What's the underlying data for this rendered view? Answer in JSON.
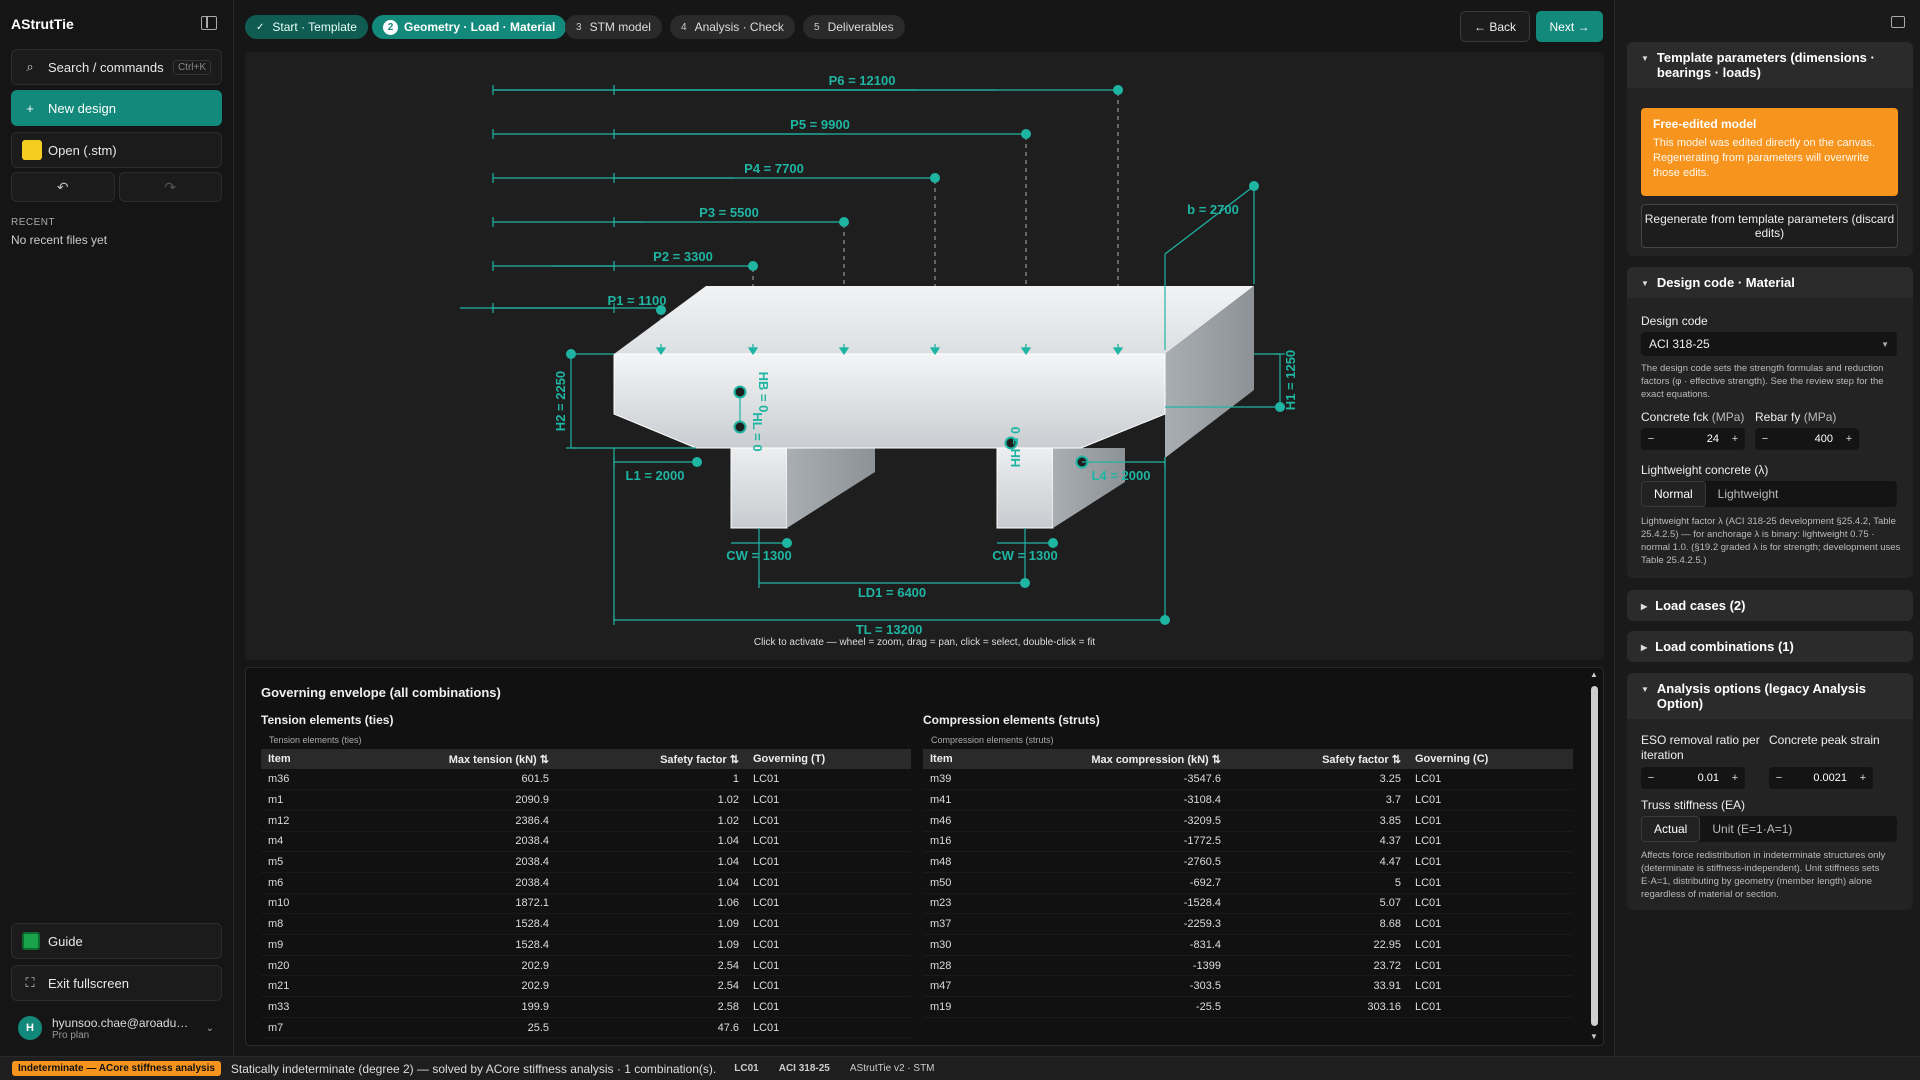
{
  "app": {
    "title": "AStrutTie"
  },
  "sidebar": {
    "search_label": "Search / commands",
    "search_shortcut": "Ctrl+K",
    "new_design_label": "New design",
    "open_label": "Open (.stm)",
    "undo_icon": "undo-icon",
    "redo_icon": "redo-icon",
    "recent_heading": "RECENT",
    "recent_empty": "No recent files yet",
    "guide_label": "Guide",
    "exit_fullscreen_label": "Exit fullscreen",
    "user": {
      "initial": "H",
      "email": "hyunsoo.chae@aroadus...",
      "plan": "Pro plan"
    }
  },
  "steps": [
    {
      "num": "✓",
      "label": "Start · Template",
      "state": "done"
    },
    {
      "num": "2",
      "label": "Geometry · Load · Material",
      "state": "active"
    },
    {
      "num": "3",
      "label": "STM model",
      "state": "todo"
    },
    {
      "num": "4",
      "label": "Analysis · Check",
      "state": "todo"
    },
    {
      "num": "5",
      "label": "Deliverables",
      "state": "todo"
    }
  ],
  "nav": {
    "back_label": "← Back",
    "next_label": "Next →"
  },
  "canvas": {
    "loads": [
      "P6 = 12100",
      "P5 = 9900",
      "P4 = 7700",
      "P3 = 5500",
      "P2 = 3300",
      "P1 = 1100"
    ],
    "dims": {
      "b": "b = 2700",
      "h2": "H2 = 2250",
      "h1": "H1 = 1250",
      "hb": "HB = 0",
      "hl": "HL = 0",
      "hh": "HH = 0",
      "l1": "L1 = 2000",
      "l4": "L4 = 2000",
      "cw_left": "CW = 1300",
      "cw_right": "CW = 1300",
      "ld1": "LD1 = 6400",
      "tl": "TL = 13200"
    },
    "hint": "Click to activate — wheel = zoom, drag = pan, click = select, double-click = fit"
  },
  "envelope": {
    "title": "Governing envelope (all combinations)",
    "tension": {
      "heading": "Tension elements (ties)",
      "caption": "Tension elements (ties)",
      "columns": [
        "Item",
        "Max tension (kN) ⇅",
        "Safety factor ⇅",
        "Governing (T)"
      ],
      "rows": [
        [
          "m36",
          "601.5",
          "1",
          "LC01"
        ],
        [
          "m1",
          "2090.9",
          "1.02",
          "LC01"
        ],
        [
          "m12",
          "2386.4",
          "1.02",
          "LC01"
        ],
        [
          "m4",
          "2038.4",
          "1.04",
          "LC01"
        ],
        [
          "m5",
          "2038.4",
          "1.04",
          "LC01"
        ],
        [
          "m6",
          "2038.4",
          "1.04",
          "LC01"
        ],
        [
          "m10",
          "1872.1",
          "1.06",
          "LC01"
        ],
        [
          "m8",
          "1528.4",
          "1.09",
          "LC01"
        ],
        [
          "m9",
          "1528.4",
          "1.09",
          "LC01"
        ],
        [
          "m20",
          "202.9",
          "2.54",
          "LC01"
        ],
        [
          "m21",
          "202.9",
          "2.54",
          "LC01"
        ],
        [
          "m33",
          "199.9",
          "2.58",
          "LC01"
        ],
        [
          "m7",
          "25.5",
          "47.6",
          "LC01"
        ]
      ]
    },
    "compression": {
      "heading": "Compression elements (struts)",
      "caption": "Compression elements (struts)",
      "columns": [
        "Item",
        "Max compression (kN) ⇅",
        "Safety factor ⇅",
        "Governing (C)"
      ],
      "rows": [
        [
          "m39",
          "-3547.6",
          "3.25",
          "LC01"
        ],
        [
          "m41",
          "-3108.4",
          "3.7",
          "LC01"
        ],
        [
          "m46",
          "-3209.5",
          "3.85",
          "LC01"
        ],
        [
          "m16",
          "-1772.5",
          "4.37",
          "LC01"
        ],
        [
          "m48",
          "-2760.5",
          "4.47",
          "LC01"
        ],
        [
          "m50",
          "-692.7",
          "5",
          "LC01"
        ],
        [
          "m23",
          "-1528.4",
          "5.07",
          "LC01"
        ],
        [
          "m37",
          "-2259.3",
          "8.68",
          "LC01"
        ],
        [
          "m30",
          "-831.4",
          "22.95",
          "LC01"
        ],
        [
          "m28",
          "-1399",
          "23.72",
          "LC01"
        ],
        [
          "m47",
          "-303.5",
          "33.91",
          "LC01"
        ],
        [
          "m19",
          "-25.5",
          "303.16",
          "LC01"
        ]
      ]
    }
  },
  "right_panel": {
    "template_params": {
      "title": "Template parameters (dimensions · bearings · loads)",
      "warning_title": "Free-edited model",
      "warning_text": "This model was edited directly on the canvas. Regenerating from parameters will overwrite those edits.",
      "regen_label": "Regenerate from template parameters (discard edits)"
    },
    "design_code": {
      "title": "Design code · Material",
      "code_label": "Design code",
      "code_value": "ACI 318-25",
      "code_note": "The design code sets the strength formulas and reduction factors (φ · effective strength). See the review step for the exact equations.",
      "fck_label": "Concrete fck",
      "fck_unit": "(MPa)",
      "fck_value": "24",
      "fy_label": "Rebar fy",
      "fy_unit": "(MPa)",
      "fy_value": "400",
      "lw_label": "Lightweight concrete (λ)",
      "lw_options": [
        "Normal",
        "Lightweight"
      ],
      "lw_note": "Lightweight factor λ (ACI 318-25 development §25.4.2, Table 25.4.2.5) — for anchorage λ is binary: lightweight 0.75 · normal 1.0. (§19.2 graded λ is for strength; development uses Table 25.4.2.5.)"
    },
    "load_cases": {
      "title": "Load cases (2)"
    },
    "load_combos": {
      "title": "Load combinations (1)"
    },
    "analysis": {
      "title": "Analysis options (legacy Analysis Option)",
      "eso_label": "ESO removal ratio per iteration",
      "eso_value": "0.01",
      "peak_label": "Concrete peak strain",
      "peak_value": "0.0021",
      "truss_label": "Truss stiffness (EA)",
      "truss_options": [
        "Actual",
        "Unit (E=1·A=1)"
      ],
      "truss_note": "Affects force redistribution in indeterminate structures only (determinate is stiffness-independent). Unit stiffness sets E·A=1, distributing by geometry (member length) alone regardless of material or section."
    }
  },
  "status": {
    "badge": "Indeterminate — ACore stiffness analysis",
    "message": "Statically indeterminate (degree 2) — solved by ACore stiffness analysis · 1 combination(s).",
    "lc": "LC01",
    "code": "ACI 318-25",
    "version": "AStrutTie v2 · STM"
  },
  "colors": {
    "accent": "#12897a",
    "warning": "#f7941d",
    "teal_line": "#1fb5a3"
  }
}
